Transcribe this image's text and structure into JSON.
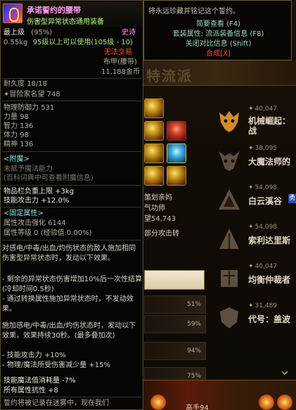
{
  "item": {
    "name": "承诺誓约的腰带",
    "subtitle": "伤害型异常状态通用装备",
    "level_label": "最上级",
    "level_percent": "(95%)",
    "rarity": "史诗",
    "weight": "0.55kg",
    "use_requirement": "95级以上可以使用(105级 - 10)",
    "trade_status": "无法交易",
    "slot_type": "布甲(腰带)",
    "price": "11,188金币",
    "durability_label": "耐久度",
    "durability": "18/18",
    "adventure_fame_label": "冒险家名望",
    "adventure_fame": "748",
    "stats": [
      {
        "label": "物理防御力",
        "value": "531"
      },
      {
        "label": "力量",
        "value": "98"
      },
      {
        "label": "智力",
        "value": "136"
      },
      {
        "label": "体力",
        "value": "98"
      },
      {
        "label": "精神",
        "value": "136"
      }
    ],
    "enchant_title": "<附魔>",
    "enchant_none": "未赋予魔法能力",
    "enchant_hint": "(百科词典中可查看附魔信息)",
    "bonus_lines": [
      "物品栏负重上限 +3kg",
      "技能攻击力 +12.0%"
    ],
    "fixed_title": "<固定属性>",
    "fixed_lines": [
      "属性攻击强化 6144",
      "属性等级 0 (经验值 0.00%)"
    ],
    "effect_paragraphs": [
      "对感电/中毒/出血/灼伤状态的敌人施加相同伤害型异常状态时，发动以下效果。",
      "- 剩余的异常状态伤害增加10%后一次性结算 (冷却时间0.5秒)",
      "- 通过转换属性施加异常状态时，不发动效果。",
      "施加感电/中毒/出血/灼伤状态时，发动以下效果，效果持续30秒。(最多叠加次)",
      "- 技能攻击力 +10%",
      "- 物理/魔法所受伤害减少量 +15%"
    ],
    "skill_mp": "技能魔法值消耗量 -7%",
    "all_resist": "所有属性抗性 +8",
    "footer": "誓约将被记录在迷雾中，现在我们"
  },
  "tooltip2": {
    "line1": "将永远珍藏并铭记这个誓约。",
    "line2": "简要查看 (F4)",
    "line3": "套装属性: 流派装备信息 (F8)",
    "line4": "关闭对比信息 (Shift)",
    "line5": "合成[X]"
  },
  "background": {
    "panel_ghost_text": "特流派",
    "char_title": "策划亲妈",
    "char_class": "气功师",
    "char_gold_prefix": "望",
    "char_gold": "54,743",
    "char_extra": "部分攻击转",
    "ranks": [
      {
        "score": "40,047",
        "name": "机械崛起：战",
        "lit": true
      },
      {
        "score": "38,095",
        "name": "大魔法师的",
        "lit": false
      },
      {
        "score": "54,098",
        "name": "白云溪谷",
        "lit": false,
        "badge": "勇"
      },
      {
        "score": "54,098",
        "name": "索利达里斯",
        "lit": false
      },
      {
        "score": "40,047",
        "name": "均衡仲裁者",
        "lit": false
      },
      {
        "score": "31,489",
        "name": "代号：盖波",
        "lit": false
      }
    ],
    "percents": [
      "51%",
      "59%",
      "94%",
      "75%"
    ],
    "bottom_label": "高手94"
  },
  "colors": {
    "epic_name": "#ff9af0",
    "uncommon": "#b0ff70",
    "cyan": "#7de8e0",
    "red": "#ff4a3a"
  }
}
